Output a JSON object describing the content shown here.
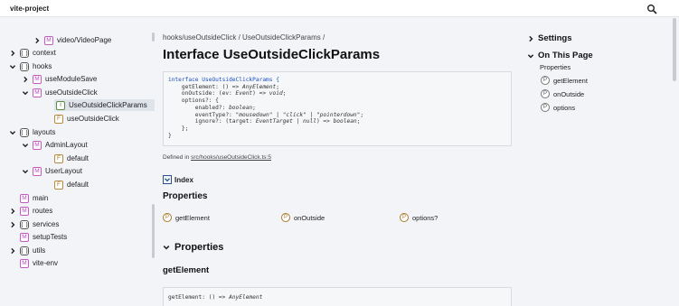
{
  "app": {
    "title": "vite-project"
  },
  "icons": {
    "search": "search-icon"
  },
  "sidebar": {
    "items": [
      {
        "label": "video/VideoPage",
        "kind": "M",
        "chevron": "right"
      },
      {
        "label": "context",
        "kind": "ns",
        "chevron": "right"
      },
      {
        "label": "hooks",
        "kind": "ns",
        "chevron": "down"
      },
      {
        "label": "useModuleSave",
        "kind": "M",
        "chevron": "right"
      },
      {
        "label": "useOutsideClick",
        "kind": "M",
        "chevron": "down"
      },
      {
        "label": "UseOutsideClickParams",
        "kind": "I",
        "chevron": "",
        "active": true
      },
      {
        "label": "useOutsideClick",
        "kind": "F",
        "chevron": ""
      },
      {
        "label": "layouts",
        "kind": "ns",
        "chevron": "down"
      },
      {
        "label": "AdminLayout",
        "kind": "M",
        "chevron": "down"
      },
      {
        "label": "default",
        "kind": "F",
        "chevron": ""
      },
      {
        "label": "UserLayout",
        "kind": "M",
        "chevron": "down"
      },
      {
        "label": "default",
        "kind": "F",
        "chevron": ""
      },
      {
        "label": "main",
        "kind": "M",
        "chevron": ""
      },
      {
        "label": "routes",
        "kind": "M",
        "chevron": "right"
      },
      {
        "label": "services",
        "kind": "ns",
        "chevron": "right"
      },
      {
        "label": "setupTests",
        "kind": "M",
        "chevron": ""
      },
      {
        "label": "utils",
        "kind": "ns",
        "chevron": "right"
      },
      {
        "label": "vite-env",
        "kind": "M",
        "chevron": ""
      }
    ]
  },
  "main": {
    "breadcrumb": [
      "hooks/useOutsideClick",
      "UseOutsideClickParams"
    ],
    "breadcrumb_sep": " / ",
    "title": "Interface UseOutsideClickParams",
    "defined_prefix": "Defined in ",
    "defined_link": "src/hooks/useOutsideClick.ts:5",
    "index_label": "Index",
    "properties_heading": "Properties",
    "properties": [
      "getElement",
      "onOutside",
      "options?"
    ],
    "section_properties": "Properties",
    "first_member": "getElement",
    "first_member_signature_name": "getElement",
    "first_member_signature_rest": ": () => ",
    "first_member_signature_type": "AnyElement"
  },
  "code": {
    "l1a": "interface ",
    "l1b": "UseOutsideClickParams {",
    "l2a": "    getElement: () => ",
    "l2b": "AnyElement",
    "l2c": ";",
    "l3a": "    onOutside: (ev: ",
    "l3b": "Event",
    "l3c": ") => ",
    "l3d": "void",
    "l3e": ";",
    "l4": "    options?: {",
    "l5a": "        enabled?: ",
    "l5b": "boolean",
    "l5c": ";",
    "l6a": "        eventType?: ",
    "l6b": "\"mousedown\"",
    "l6c": " | ",
    "l6d": "\"click\"",
    "l6e": " | ",
    "l6f": "\"pointerdown\"",
    "l6g": ";",
    "l7a": "        ignore?: (target: ",
    "l7b": "EventTarget",
    "l7c": " | ",
    "l7d": "null",
    "l7e": ") => ",
    "l7f": "boolean",
    "l7g": ";",
    "l8": "    };",
    "l9": "}"
  },
  "right": {
    "settings": "Settings",
    "on_this_page": "On This Page",
    "properties": "Properties",
    "items": [
      "getElement",
      "onOutside",
      "options"
    ]
  },
  "colors": {
    "accent": "#2a4f8f",
    "keyword": "#1a4fc2",
    "string": "#a0362f"
  }
}
